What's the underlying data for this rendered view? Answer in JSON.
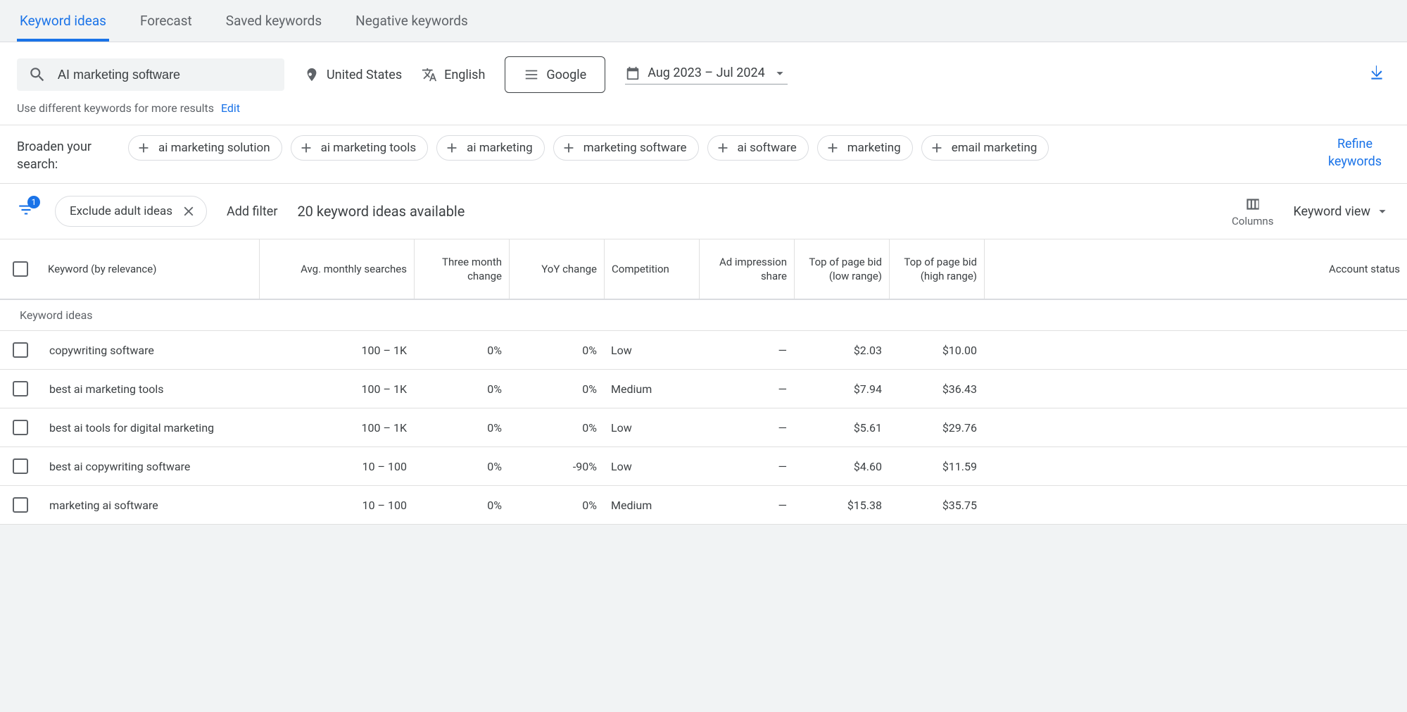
{
  "tabs": {
    "keyword_ideas": "Keyword ideas",
    "forecast": "Forecast",
    "saved_keywords": "Saved keywords",
    "negative_keywords": "Negative keywords"
  },
  "controls": {
    "search_value": "AI marketing software",
    "location": "United States",
    "language": "English",
    "network": "Google",
    "date_range": "Aug 2023 – Jul 2024"
  },
  "hint": {
    "text": "Use different keywords for more results",
    "edit": "Edit"
  },
  "broaden": {
    "label": "Broaden your search:",
    "chips": [
      "ai marketing solution",
      "ai marketing tools",
      "ai marketing",
      "marketing software",
      "ai software",
      "marketing",
      "email marketing"
    ],
    "refine": "Refine keywords"
  },
  "filters": {
    "badge": "1",
    "exclude_adult": "Exclude adult ideas",
    "add_filter": "Add filter",
    "ideas_available": "20 keyword ideas available",
    "columns_label": "Columns",
    "view_label": "Keyword view"
  },
  "table": {
    "headers": {
      "keyword": "Keyword (by relevance)",
      "avg_searches": "Avg. monthly searches",
      "three_month": "Three month change",
      "yoy": "YoY change",
      "competition": "Competition",
      "ad_impression": "Ad impression share",
      "low_bid": "Top of page bid (low range)",
      "high_bid": "Top of page bid (high range)",
      "account_status": "Account status"
    },
    "section_label": "Keyword ideas",
    "rows": [
      {
        "keyword": "copywriting software",
        "avg": "100 – 1K",
        "three": "0%",
        "yoy": "0%",
        "comp": "Low",
        "adimp": "—",
        "low": "$2.03",
        "high": "$10.00",
        "status": ""
      },
      {
        "keyword": "best ai marketing tools",
        "avg": "100 – 1K",
        "three": "0%",
        "yoy": "0%",
        "comp": "Medium",
        "adimp": "—",
        "low": "$7.94",
        "high": "$36.43",
        "status": ""
      },
      {
        "keyword": "best ai tools for digital marketing",
        "avg": "100 – 1K",
        "three": "0%",
        "yoy": "0%",
        "comp": "Low",
        "adimp": "—",
        "low": "$5.61",
        "high": "$29.76",
        "status": ""
      },
      {
        "keyword": "best ai copywriting software",
        "avg": "10 – 100",
        "three": "0%",
        "yoy": "-90%",
        "comp": "Low",
        "adimp": "—",
        "low": "$4.60",
        "high": "$11.59",
        "status": ""
      },
      {
        "keyword": "marketing ai software",
        "avg": "10 – 100",
        "three": "0%",
        "yoy": "0%",
        "comp": "Medium",
        "adimp": "—",
        "low": "$15.38",
        "high": "$35.75",
        "status": ""
      }
    ]
  }
}
